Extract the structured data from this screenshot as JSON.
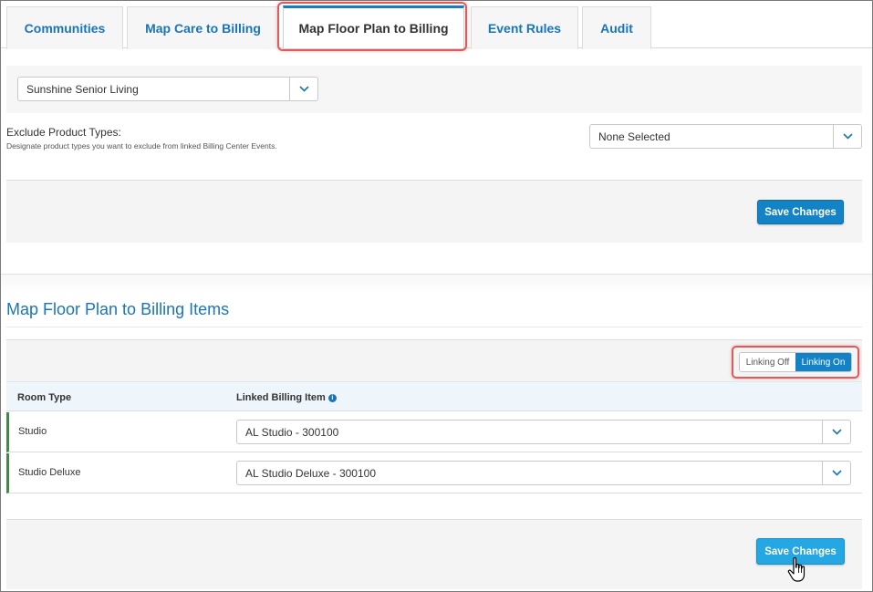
{
  "tabs": [
    {
      "label": "Communities",
      "active": false
    },
    {
      "label": "Map Care to Billing",
      "active": false
    },
    {
      "label": "Map Floor Plan to Billing",
      "active": true
    },
    {
      "label": "Event Rules",
      "active": false
    },
    {
      "label": "Audit",
      "active": false
    }
  ],
  "community_select": {
    "value": "Sunshine Senior Living"
  },
  "exclude": {
    "label": "Exclude Product Types:",
    "description": "Designate product types you want to exclude from linked Billing Center Events.",
    "value": "None Selected"
  },
  "save_label": "Save Changes",
  "section_title": "Map Floor Plan to Billing Items",
  "linking": {
    "off_label": "Linking Off",
    "on_label": "Linking On",
    "state": "on"
  },
  "table": {
    "headers": [
      "Room Type",
      "Linked Billing Item"
    ],
    "rows": [
      {
        "room_type": "Studio",
        "billing_item": "AL Studio - 300100"
      },
      {
        "room_type": "Studio Deluxe",
        "billing_item": "AL Studio Deluxe - 300100"
      }
    ]
  },
  "icons": {
    "caret": "chevron-down-icon",
    "info": "info-icon",
    "cursor": "hand-pointer-icon"
  },
  "colors": {
    "accent": "#1383c6",
    "link": "#1a75b8",
    "highlight": "#e05a5a",
    "row_marker": "#3c8c46"
  }
}
